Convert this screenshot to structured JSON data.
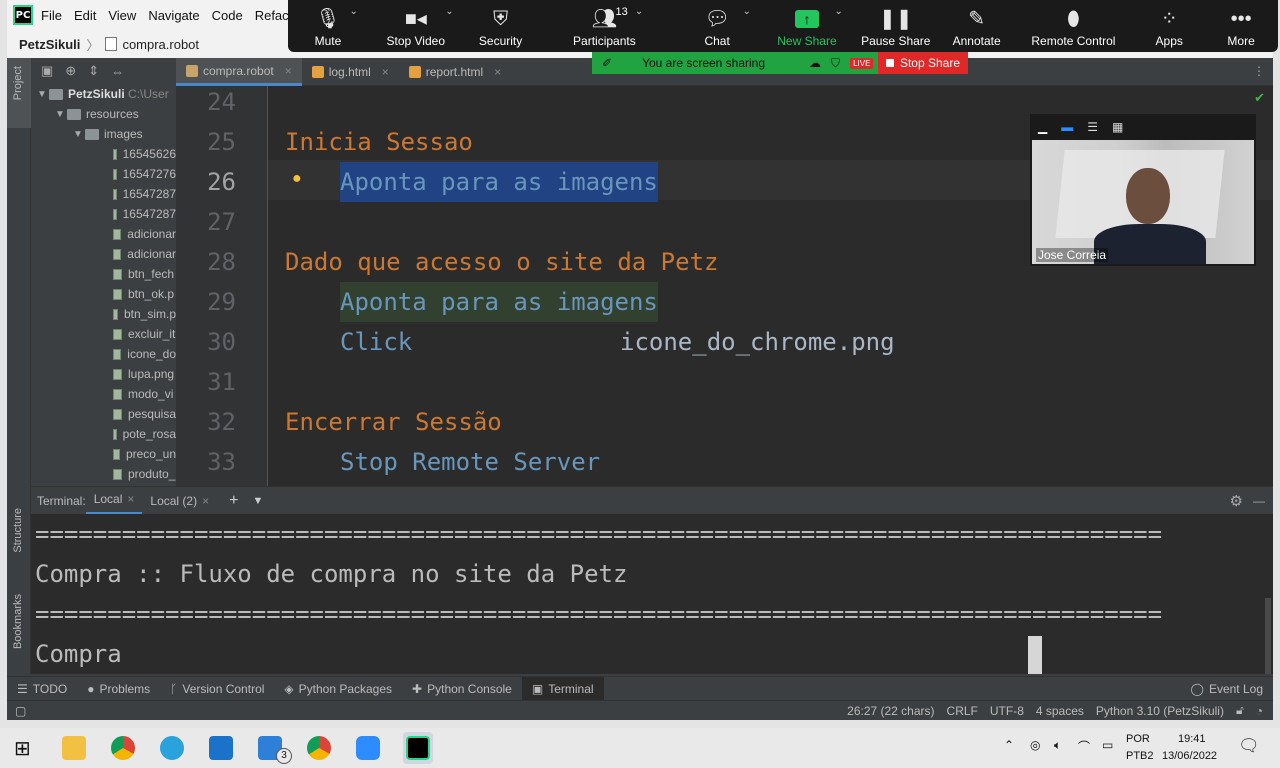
{
  "menu": [
    "File",
    "Edit",
    "View",
    "Navigate",
    "Code",
    "Refactor"
  ],
  "app_logo": "PC",
  "breadcrumb": {
    "project": "PetzSikuli",
    "file": "compra.robot"
  },
  "left_stripe": {
    "project": "Project",
    "structure": "Structure",
    "bookmarks": "Bookmarks"
  },
  "project_tree": {
    "root": "PetzSikuli",
    "root_path": "C:\\User",
    "resources": "resources",
    "images": "images",
    "files": [
      "16545626",
      "16547276",
      "16547287",
      "16547287",
      "adicionar",
      "adicionar",
      "btn_fech",
      "btn_ok.p",
      "btn_sim.p",
      "excluir_it",
      "icone_do",
      "lupa.png",
      "modo_vi",
      "pesquisa",
      "pote_rosa",
      "preco_un",
      "produto_"
    ]
  },
  "editor_tabs": [
    {
      "label": "compra.robot",
      "active": true
    },
    {
      "label": "log.html",
      "active": false
    },
    {
      "label": "report.html",
      "active": false
    }
  ],
  "code_lines": [
    {
      "num": "24",
      "parts": []
    },
    {
      "num": "25",
      "parts": [
        {
          "cls": "kw",
          "text": "Inicia Sessao"
        }
      ]
    },
    {
      "num": "26",
      "parts": [
        {
          "cls": "call",
          "text": "Aponta para as imagens"
        }
      ]
    },
    {
      "num": "27",
      "parts": []
    },
    {
      "num": "28",
      "parts": [
        {
          "cls": "kw",
          "text": "Dado que acesso o site da Petz"
        }
      ]
    },
    {
      "num": "29",
      "parts": [
        {
          "cls": "call",
          "text": "Aponta para as imagens"
        }
      ]
    },
    {
      "num": "30",
      "parts": [
        {
          "cls": "call",
          "text": "Click"
        },
        {
          "cls": "plain",
          "text": "icone_do_chrome.png"
        }
      ]
    },
    {
      "num": "31",
      "parts": []
    },
    {
      "num": "32",
      "parts": [
        {
          "cls": "kw",
          "text": "Encerrar Sessão"
        }
      ]
    },
    {
      "num": "33",
      "parts": [
        {
          "cls": "call",
          "text": "Stop Remote Server"
        }
      ]
    }
  ],
  "terminal": {
    "label": "Terminal:",
    "tabs": [
      "Local",
      "Local (2)"
    ],
    "lines": [
      "==============================================================================",
      "Compra :: Fluxo de compra no site da Petz",
      "==============================================================================",
      "Compra"
    ]
  },
  "tool_windows": [
    "TODO",
    "Problems",
    "Version Control",
    "Python Packages",
    "Python Console",
    "Terminal"
  ],
  "event_log": "Event Log",
  "status": {
    "position": "26:27 (22 chars)",
    "line_sep": "CRLF",
    "encoding": "UTF-8",
    "indent": "4 spaces",
    "interpreter": "Python 3.10 (PetzSikuli)"
  },
  "zoom": {
    "buttons": [
      "Mute",
      "Stop Video",
      "Security",
      "Participants",
      "Chat",
      "New Share",
      "Pause Share",
      "Annotate",
      "Remote Control",
      "Apps",
      "More"
    ],
    "participants_count": "13",
    "sharing_text": "You are screen sharing",
    "live": "LIVE",
    "stop_share": "Stop Share",
    "video_name": "Jose Correia"
  },
  "tray": {
    "lang": "POR",
    "layout": "PTB2",
    "time": "19:41",
    "date": "13/06/2022",
    "badge": "3"
  },
  "colors": {
    "keyword": "#cc7832",
    "call": "#6897bb",
    "selection": "#214283",
    "zoom_green": "#22a342",
    "stop_red": "#e02828"
  }
}
